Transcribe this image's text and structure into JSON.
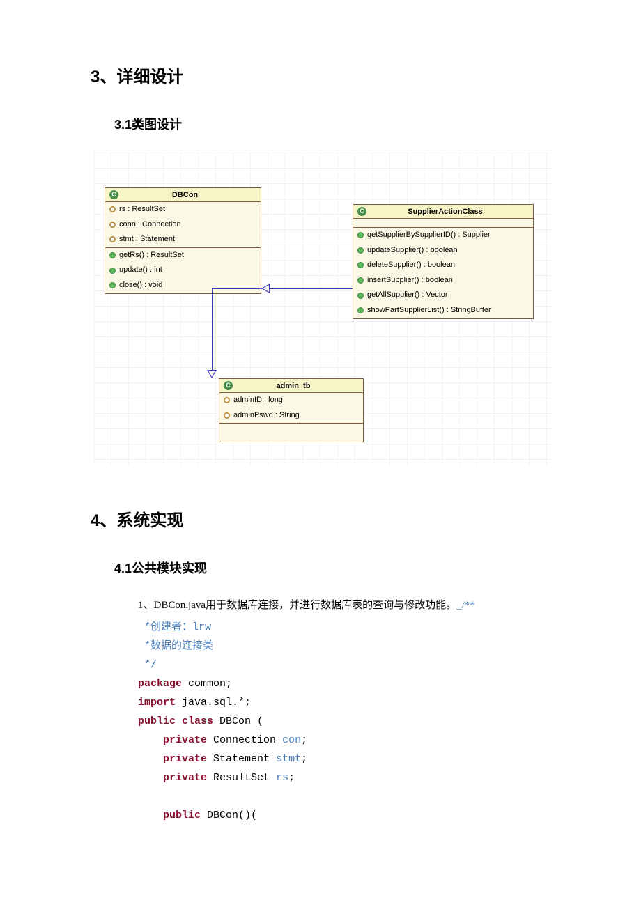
{
  "s3": {
    "heading": "3、详细设计",
    "sub1": "3.1类图设计"
  },
  "uml": {
    "dbcon": {
      "title": "DBCon",
      "attrs": [
        "rs : ResultSet",
        "conn : Connection",
        "stmt : Statement"
      ],
      "ops": [
        "getRs() : ResultSet",
        "update() : int",
        "close() : void"
      ]
    },
    "supplier": {
      "title": "SupplierActionClass",
      "ops": [
        "getSupplierBySupplierID() : Supplier",
        "updateSupplier() : boolean",
        "deleteSupplier() : boolean",
        "insertSupplier() : boolean",
        "getAllSupplier() : Vector",
        "showPartSupplierList() : StringBuffer"
      ]
    },
    "admin": {
      "title": "admin_tb",
      "attrs": [
        "adminID : long",
        "adminPswd : String"
      ]
    }
  },
  "s4": {
    "heading": "4、系统实现",
    "sub1": "4.1公共模块实现",
    "intro_prefix": "1、DBCon.java用于数据库连接，并进行数据库表的查询与修改功能。",
    "comment_open": "_/**",
    "comment_l1": " *创建者：",
    "comment_author": "lrw",
    "comment_l2": " *数据的连接类",
    "comment_l3": " */",
    "kw_package": "package",
    "pkg_name": " common;",
    "kw_import": "import",
    "import_name": " java.sql.*;",
    "kw_public": "public",
    "kw_class": "class",
    "class_name": " DBCon (",
    "kw_private": "private",
    "type_conn": " Connection ",
    "var_con": "con",
    "type_stmt": " Statement ",
    "var_stmt": "stmt",
    "type_rs": " ResultSet ",
    "var_rs": "rs",
    "ctor": " DBCon()(",
    "semi": ";"
  }
}
